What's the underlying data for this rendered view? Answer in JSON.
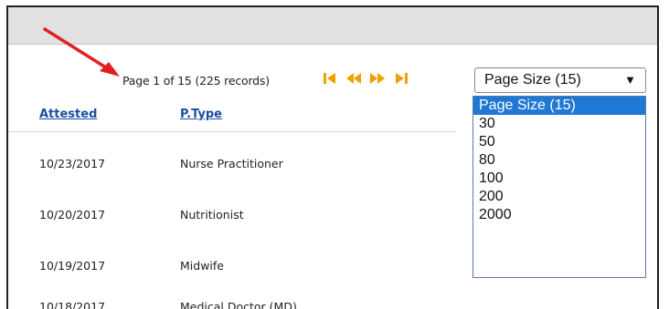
{
  "pager": {
    "status_text": "Page 1 of 15 (225 records)",
    "buttons": [
      {
        "name": "first-page-icon"
      },
      {
        "name": "previous-page-icon"
      },
      {
        "name": "next-page-icon"
      },
      {
        "name": "last-page-icon"
      }
    ],
    "accent_color": "#f0a000"
  },
  "page_size": {
    "selected_label": "Page Size (15)",
    "caret": "▼",
    "options": [
      "Page Size (15)",
      "30",
      "50",
      "80",
      "100",
      "200",
      "2000"
    ],
    "highlight_color": "#1e78d4"
  },
  "table": {
    "columns": [
      "Attested",
      "P.Type"
    ],
    "rows": [
      {
        "attested": "10/23/2017",
        "ptype": "Nurse Practitioner"
      },
      {
        "attested": "10/20/2017",
        "ptype": "Nutritionist"
      },
      {
        "attested": "10/19/2017",
        "ptype": "Midwife"
      },
      {
        "attested": "10/18/2017",
        "ptype": "Medical Doctor (MD)"
      }
    ]
  },
  "annotation": {
    "arrow_color": "#e02020"
  }
}
